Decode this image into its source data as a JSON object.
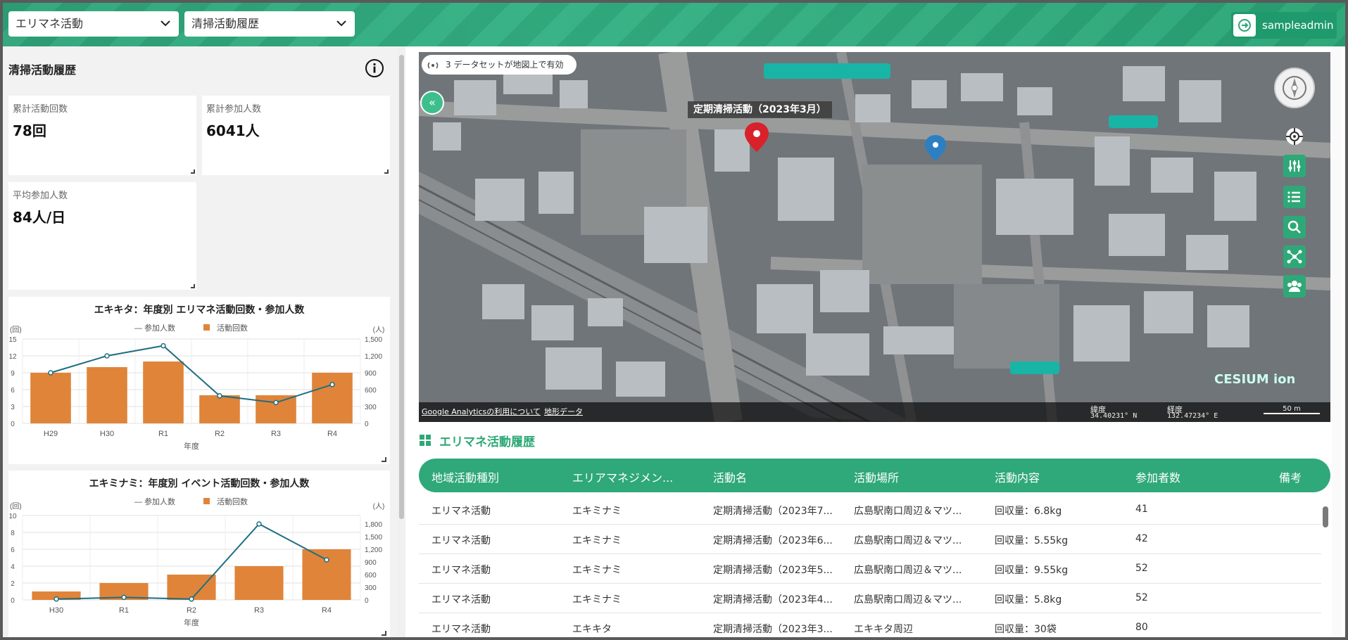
{
  "header": {
    "select1": "エリマネ活動",
    "select2": "清掃活動履歴",
    "user": "sampleadmin"
  },
  "left": {
    "title": "清掃活動履歴",
    "stats": [
      {
        "label": "累計活動回数",
        "value": "78回"
      },
      {
        "label": "累計参加人数",
        "value": "6041人"
      },
      {
        "label": "平均参加人数",
        "value": "84人/日"
      }
    ]
  },
  "chart_data": [
    {
      "type": "bar",
      "title": "エキキタ：年度別 エリマネ活動回数・参加人数",
      "categories": [
        "H29",
        "H30",
        "R1",
        "R2",
        "R3",
        "R4"
      ],
      "xlabel": "年度",
      "ylabel_left": "(回)",
      "ylabel_right": "(人)",
      "ylim_left": [
        0,
        15
      ],
      "ylim_right": [
        0,
        1500
      ],
      "left_ticks": [
        "0",
        "3",
        "6",
        "9",
        "12",
        "15"
      ],
      "right_ticks": [
        "0",
        "300",
        "600",
        "900",
        "1,200",
        "1,500"
      ],
      "legend": [
        "参加人数",
        "活動回数"
      ],
      "series": [
        {
          "name": "活動回数",
          "type": "bar",
          "values": [
            9,
            10,
            11,
            5,
            5,
            9
          ]
        },
        {
          "name": "参加人数",
          "type": "line",
          "values": [
            900,
            1200,
            1380,
            490,
            370,
            690
          ]
        }
      ],
      "colors": {
        "bar": "#e0843a",
        "line": "#1e6e82"
      }
    },
    {
      "type": "bar",
      "title": "エキミナミ：年度別 イベント活動回数・参加人数",
      "categories": [
        "H30",
        "R1",
        "R2",
        "R3",
        "R4"
      ],
      "xlabel": "年度",
      "ylabel_left": "(回)",
      "ylabel_right": "(人)",
      "ylim_left": [
        0,
        10
      ],
      "ylim_right": [
        0,
        2000
      ],
      "left_ticks": [
        "0",
        "2",
        "4",
        "6",
        "8",
        "10"
      ],
      "right_ticks": [
        "0",
        "300",
        "600",
        "900",
        "1,200",
        "1,500",
        "1,800"
      ],
      "legend": [
        "参加人数",
        "活動回数"
      ],
      "series": [
        {
          "name": "活動回数",
          "type": "bar",
          "values": [
            1,
            2,
            3,
            4,
            6
          ]
        },
        {
          "name": "参加人数",
          "type": "line",
          "values": [
            20,
            60,
            20,
            1800,
            950
          ]
        }
      ],
      "colors": {
        "bar": "#e0843a",
        "line": "#1e6e82"
      }
    }
  ],
  "map": {
    "dataset_status": "3 データセットが地図上で有効",
    "popup": "定期清掃活動（2023年3月）",
    "footer_links": [
      "Google Analyticsの利用について",
      "地形データ"
    ],
    "lat_label": "緯度",
    "lat": "34.40231° N",
    "lon_label": "経度",
    "lon": "132.47234° E",
    "scale": "50 m",
    "logo": "CESIUM ion"
  },
  "table": {
    "title": "エリマネ活動履歴",
    "columns": [
      "地域活動種別",
      "エリアマネジメン...",
      "活動名",
      "活動場所",
      "活動内容",
      "参加者数",
      "備考"
    ],
    "rows": [
      [
        "エリマネ活動",
        "エキミナミ",
        "定期清掃活動（2023年7...",
        "広島駅南口周辺＆マツ...",
        "回収量：6.8kg",
        "41",
        ""
      ],
      [
        "エリマネ活動",
        "エキミナミ",
        "定期清掃活動（2023年6...",
        "広島駅南口周辺＆マツ...",
        "回収量：5.55kg",
        "42",
        ""
      ],
      [
        "エリマネ活動",
        "エキミナミ",
        "定期清掃活動（2023年5...",
        "広島駅南口周辺＆マツ...",
        "回収量：9.55kg",
        "52",
        ""
      ],
      [
        "エリマネ活動",
        "エキミナミ",
        "定期清掃活動（2023年4...",
        "広島駅南口周辺＆マツ...",
        "回収量：5.8kg",
        "52",
        ""
      ],
      [
        "エリマネ活動",
        "エキキタ",
        "定期清掃活動（2023年3...",
        "エキキタ周辺",
        "回収量：30袋",
        "80",
        ""
      ]
    ]
  }
}
